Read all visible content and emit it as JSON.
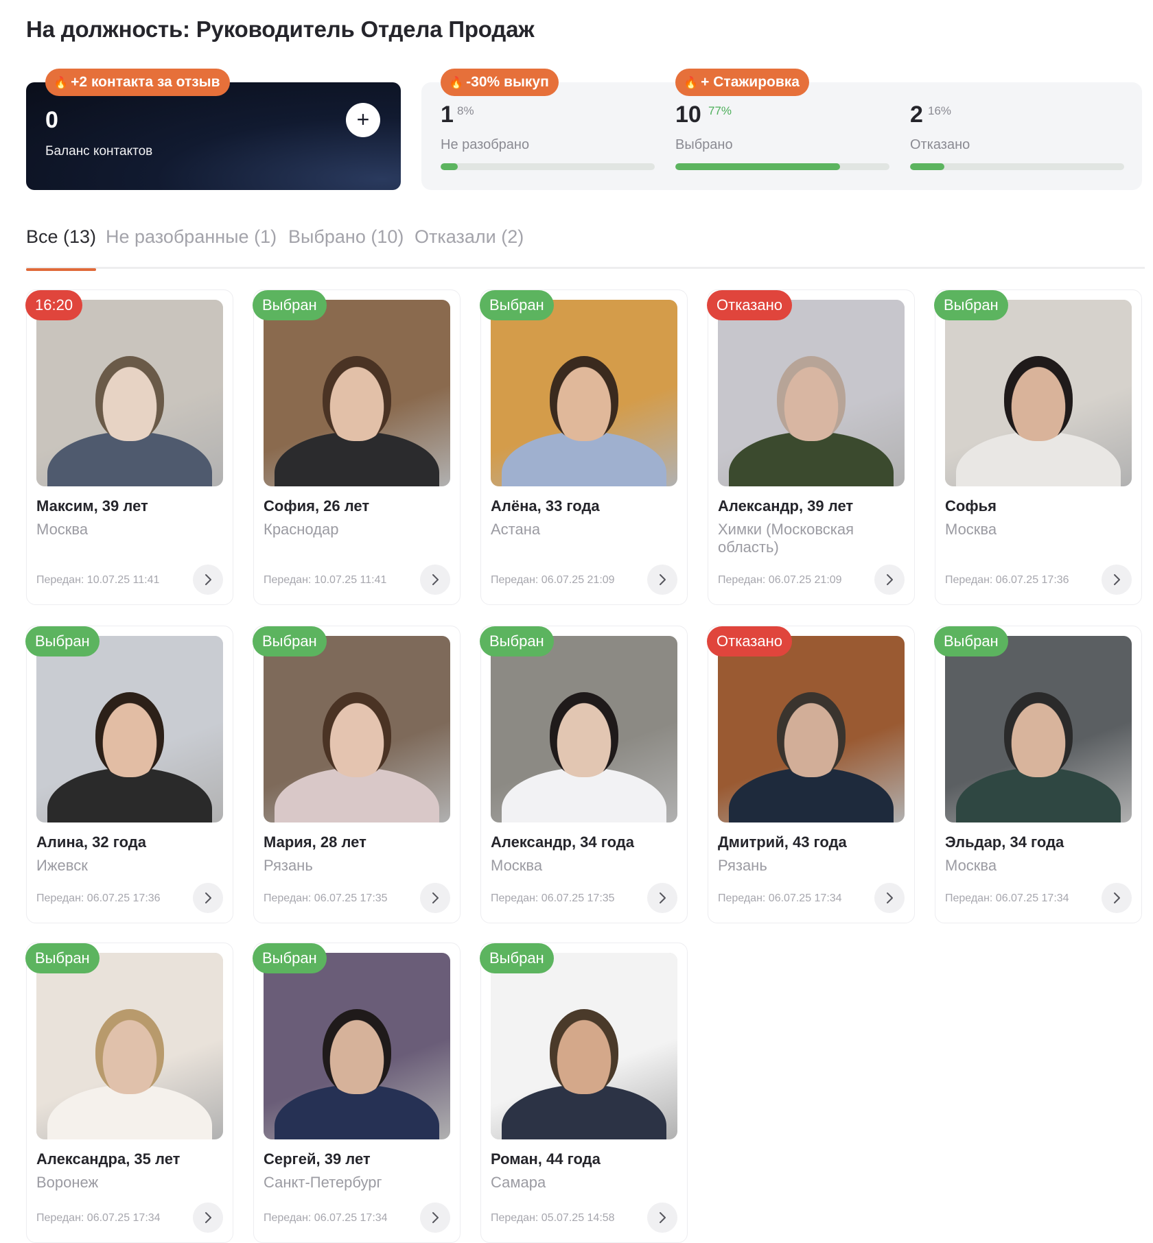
{
  "title": "На должность: Руководитель Отдела Продаж",
  "balance": {
    "value": "0",
    "label": "Баланс контактов",
    "promo": "+2 контакта за отзыв",
    "add_icon": "plus-icon"
  },
  "stats": [
    {
      "value": "1",
      "percent": "8%",
      "label": "Не разобрано",
      "fraction": 0.08,
      "promo": "-30% выкуп",
      "percent_color": "#8a8a92"
    },
    {
      "value": "10",
      "percent": "77%",
      "label": "Выбрано",
      "fraction": 0.77,
      "promo": "+ Стажировка",
      "percent_color": "#4caf5a"
    },
    {
      "value": "2",
      "percent": "16%",
      "label": "Отказано",
      "fraction": 0.16,
      "promo": "",
      "percent_color": "#8a8a92"
    }
  ],
  "tabs": [
    {
      "label": "Все (13)",
      "active": true
    },
    {
      "label": "Не разобранные (1)",
      "active": false
    },
    {
      "label": "Выбрано (10)",
      "active": false
    },
    {
      "label": "Отказали (2)",
      "active": false
    }
  ],
  "colors": {
    "accent": "#e6703a",
    "green": "#5cb45f",
    "red": "#e0453c"
  },
  "candidates": [
    {
      "badge": "16:20",
      "status": "red",
      "name": "Максим, 39 лет",
      "city": "Москва",
      "date": "Передан: 10.07.25 11:41"
    },
    {
      "badge": "Выбран",
      "status": "green",
      "name": "София, 26 лет",
      "city": "Краснодар",
      "date": "Передан: 10.07.25 11:41"
    },
    {
      "badge": "Выбран",
      "status": "green",
      "name": "Алёна, 33 года",
      "city": "Астана",
      "date": "Передан: 06.07.25 21:09"
    },
    {
      "badge": "Отказано",
      "status": "red",
      "name": "Александр, 39 лет",
      "city": "Химки (Московская область)",
      "date": "Передан: 06.07.25 21:09"
    },
    {
      "badge": "Выбран",
      "status": "green",
      "name": "Софья",
      "city": "Москва",
      "date": "Передан: 06.07.25 17:36"
    },
    {
      "badge": "Выбран",
      "status": "green",
      "name": "Алина, 32 года",
      "city": "Ижевск",
      "date": "Передан: 06.07.25 17:36"
    },
    {
      "badge": "Выбран",
      "status": "green",
      "name": "Мария, 28 лет",
      "city": "Рязань",
      "date": "Передан: 06.07.25 17:35"
    },
    {
      "badge": "Выбран",
      "status": "green",
      "name": "Александр, 34 года",
      "city": "Москва",
      "date": "Передан: 06.07.25 17:35"
    },
    {
      "badge": "Отказано",
      "status": "red",
      "name": "Дмитрий, 43 года",
      "city": "Рязань",
      "date": "Передан: 06.07.25 17:34"
    },
    {
      "badge": "Выбран",
      "status": "green",
      "name": "Эльдар, 34 года",
      "city": "Москва",
      "date": "Передан: 06.07.25 17:34"
    },
    {
      "badge": "Выбран",
      "status": "green",
      "name": "Александра, 35 лет",
      "city": "Воронеж",
      "date": "Передан: 06.07.25 17:34"
    },
    {
      "badge": "Выбран",
      "status": "green",
      "name": "Сергей, 39 лет",
      "city": "Санкт-Петербург",
      "date": "Передан: 06.07.25 17:34"
    },
    {
      "badge": "Выбран",
      "status": "green",
      "name": "Роман, 44 года",
      "city": "Самара",
      "date": "Передан: 05.07.25 14:58"
    }
  ]
}
